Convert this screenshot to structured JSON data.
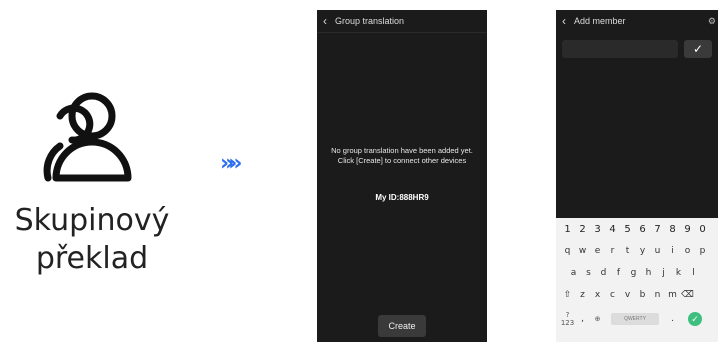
{
  "feature": {
    "title_line1": "Skupinový",
    "title_line2": "překlad",
    "icon": "group-people-icon",
    "arrow_glyph": "»»"
  },
  "screen_group": {
    "header_title": "Group translation",
    "back_icon": "chevron-left-icon",
    "empty_message": "No group translation have been added yet. Click [Create] to connect other devices",
    "my_id_label": "My ID:888HR9",
    "create_label": "Create"
  },
  "screen_add": {
    "header_title": "Add member",
    "back_icon": "chevron-left-icon",
    "settings_icon": "gear-icon",
    "input_value": "",
    "confirm_icon": "check-icon",
    "keyboard": {
      "numbers": [
        "1",
        "2",
        "3",
        "4",
        "5",
        "6",
        "7",
        "8",
        "9",
        "0"
      ],
      "row1": [
        "q",
        "w",
        "e",
        "r",
        "t",
        "y",
        "u",
        "i",
        "o",
        "p"
      ],
      "row2": [
        "a",
        "s",
        "d",
        "f",
        "g",
        "h",
        "j",
        "k",
        "l"
      ],
      "row3": [
        "z",
        "x",
        "c",
        "v",
        "b",
        "n",
        "m"
      ],
      "symbols_label": "?123",
      "comma_label": ",",
      "space_label": "QWERTY",
      "period_label": "."
    }
  },
  "colors": {
    "arrow": "#2e6ff0",
    "phone_bg": "#1b1b1b",
    "enter_key": "#3fbf7f"
  }
}
